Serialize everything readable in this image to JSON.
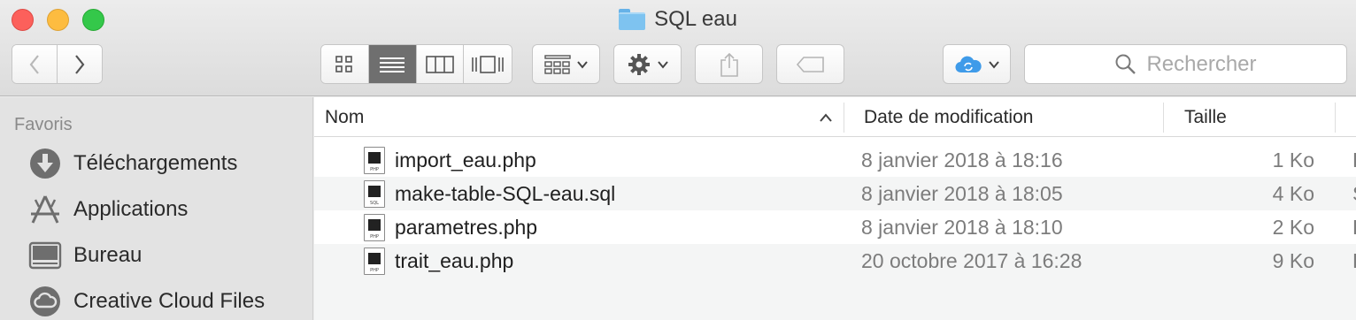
{
  "window": {
    "title": "SQL eau"
  },
  "toolbar": {
    "search_placeholder": "Rechercher"
  },
  "sidebar": {
    "header": "Favoris",
    "items": [
      {
        "label": "Téléchargements",
        "icon": "download-icon"
      },
      {
        "label": "Applications",
        "icon": "applications-icon"
      },
      {
        "label": "Bureau",
        "icon": "desktop-icon"
      },
      {
        "label": "Creative Cloud Files",
        "icon": "creative-cloud-icon"
      }
    ]
  },
  "columns": {
    "name": "Nom",
    "date": "Date de modification",
    "size": "Taille"
  },
  "files": [
    {
      "name": "import_eau.php",
      "date": "8 janvier 2018 à 18:16",
      "size": "1 Ko",
      "kind": "P",
      "badge": "PHP"
    },
    {
      "name": "make-table-SQL-eau.sql",
      "date": "8 janvier 2018 à 18:05",
      "size": "4 Ko",
      "kind": "S",
      "badge": "SQL"
    },
    {
      "name": "parametres.php",
      "date": "8 janvier 2018 à 18:10",
      "size": "2 Ko",
      "kind": "P",
      "badge": "PHP"
    },
    {
      "name": "trait_eau.php",
      "date": "20 octobre 2017 à 16:28",
      "size": "9 Ko",
      "kind": "P",
      "badge": "PHP"
    }
  ]
}
